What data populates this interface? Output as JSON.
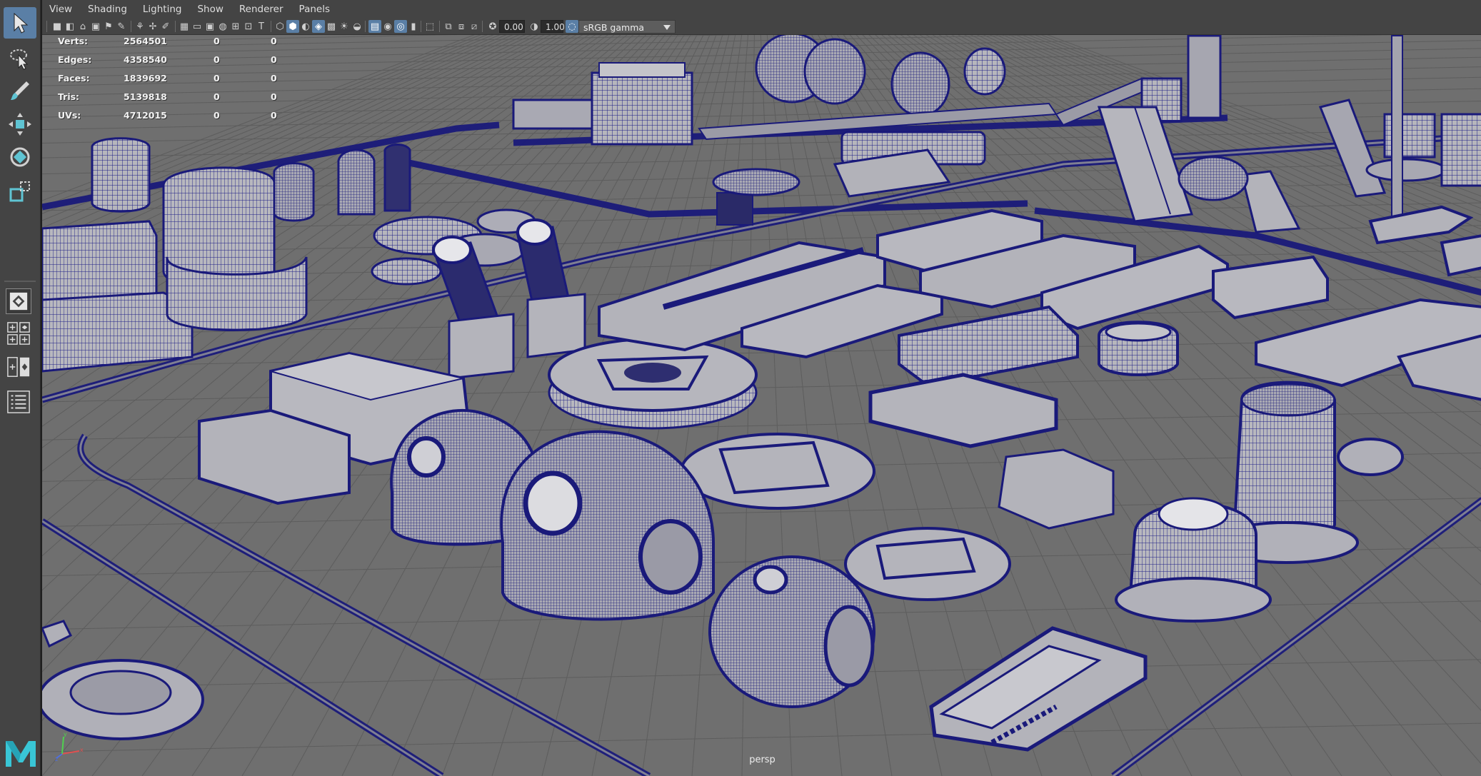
{
  "menu": [
    "View",
    "Shading",
    "Lighting",
    "Show",
    "Renderer",
    "Panels"
  ],
  "panel_toolbar": {
    "exposure_value": "0.00",
    "gamma_value": "1.00",
    "color_space": "sRGB gamma"
  },
  "hud": {
    "rows": [
      {
        "label": "Verts:",
        "total": "2564501",
        "selected": "0",
        "component": "0"
      },
      {
        "label": "Edges:",
        "total": "4358540",
        "selected": "0",
        "component": "0"
      },
      {
        "label": "Faces:",
        "total": "1839692",
        "selected": "0",
        "component": "0"
      },
      {
        "label": "Tris:",
        "total": "5139818",
        "selected": "0",
        "component": "0"
      },
      {
        "label": "UVs:",
        "total": "4712015",
        "selected": "0",
        "component": "0"
      }
    ]
  },
  "camera_label": "persp",
  "colors": {
    "viewport_bg": "#6f6f6f",
    "wireframe": "#1a1a7a",
    "surface": "#b6b6bc",
    "ui_panel": "#444444",
    "accent": "#5a7fa6",
    "logo": "#39c6d6"
  },
  "icons": {
    "toolbox": [
      "select-arrow-icon",
      "lasso-select-icon",
      "paint-select-icon",
      "move-icon",
      "rotate-icon",
      "scale-icon"
    ],
    "layouts": [
      "single-view-layout-icon",
      "four-view-layout-icon",
      "two-view-layout-icon",
      "outliner-layout-icon"
    ]
  }
}
